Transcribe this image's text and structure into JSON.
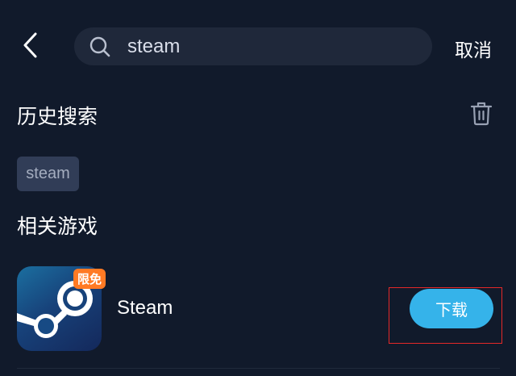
{
  "header": {
    "back_icon": "chevron-left-icon",
    "search": {
      "icon": "search-icon",
      "value": "steam"
    },
    "cancel_label": "取消"
  },
  "history": {
    "title": "历史搜索",
    "clear_icon": "trash-icon",
    "items": [
      "steam"
    ]
  },
  "related": {
    "title": "相关游戏",
    "games": [
      {
        "name": "Steam",
        "badge": "限免",
        "icon": "steam-logo-icon",
        "action_label": "下载"
      }
    ]
  },
  "colors": {
    "background": "#111a2b",
    "search_background": "#1f283a",
    "chip_background": "#313d57",
    "download_button": "#35b3ea",
    "badge": "#ff7a24",
    "highlight_outline": "#e52828"
  }
}
